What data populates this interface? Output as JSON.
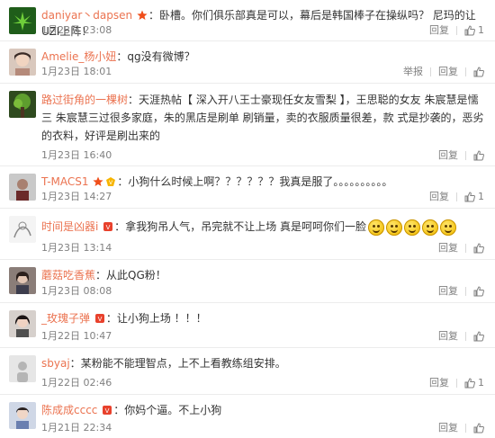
{
  "ui": {
    "reply_label": "回复",
    "report_label": "举报",
    "link_color": "#eb7350"
  },
  "comments": [
    {
      "name": "daniyar丶dapsen",
      "text": "卧槽。你们俱乐部真是可以，幕后是韩国棒子在操纵吗？ 尼玛的让UZI上阵！",
      "time": "1月23日 23:08",
      "likes": "1",
      "show_report": false,
      "avatar": "weed-leaf-avatar"
    },
    {
      "name": "Amelie_杨小妞",
      "text": "qg没有微博？",
      "time": "1月23日 18:01",
      "likes": "",
      "show_report": true,
      "avatar": "girl-avatar"
    },
    {
      "name": "路过街角的一棵树",
      "text": "天涯热帖【 深入开八王士豪现任女友雪梨 】，王思聪的女友 朱宸慧是懦三 朱宸慧三过很多家庭，朱的黑店是刷单 刷销量，卖的衣服质量很差，款 式是抄袭的，恶劣的衣料，好评是刷出来的",
      "time": "1月23日 16:40",
      "likes": "",
      "show_report": false,
      "avatar": "tree-avatar"
    },
    {
      "name": "T-MACS1",
      "text": "小狗什么时候上啊？？？？？？我真是服了。。。。。。。。。。",
      "time": "1月23日 14:27",
      "likes": "1",
      "show_report": false,
      "avatar": "person-avatar"
    },
    {
      "name": "时间是凶器i",
      "text": "拿我狗吊人气，吊完就不让上场 真是呵呵你们一脸",
      "time": "1月23日 13:14",
      "likes": "",
      "show_report": false,
      "avatar": "sketch-avatar"
    },
    {
      "name": "蘑菇吃香蕉",
      "text": "从此QG粉！",
      "time": "1月23日 08:08",
      "likes": "",
      "show_report": false,
      "avatar": "portrait-avatar"
    },
    {
      "name": "_玫瑰子弹",
      "text": "让小狗上场 ！！！",
      "time": "1月22日 10:47",
      "likes": "",
      "show_report": false,
      "avatar": "dark-hair-avatar"
    },
    {
      "name": "sbyaj",
      "text": "某粉能不能理智点，上不上看教练组安排。",
      "time": "1月22日 02:46",
      "likes": "1",
      "show_report": false,
      "avatar": "gray-avatar"
    },
    {
      "name": "陈成成cccc",
      "text": "你妈个逼。不上小狗",
      "time": "1月21日 22:34",
      "likes": "",
      "show_report": false,
      "avatar": "boy-avatar"
    }
  ]
}
